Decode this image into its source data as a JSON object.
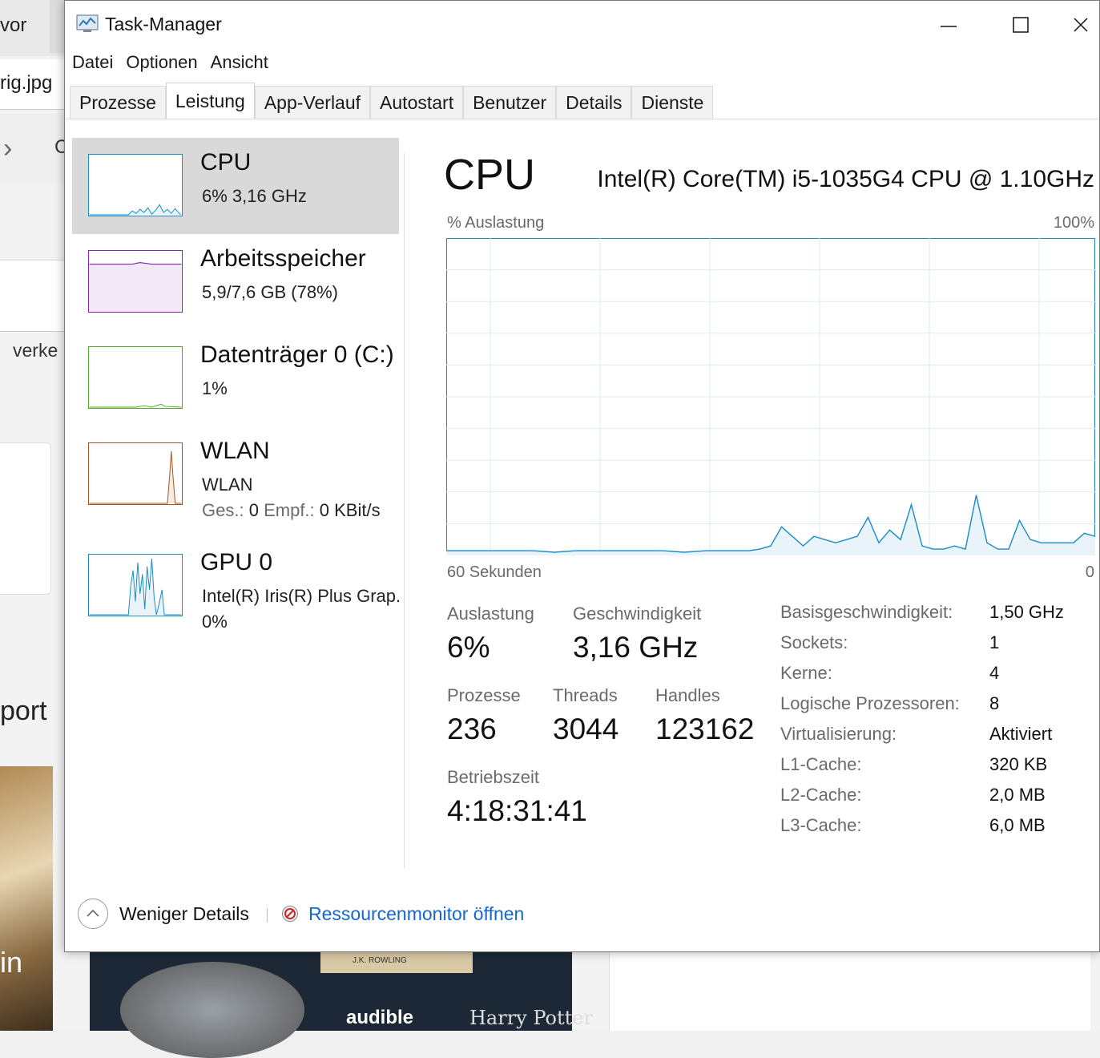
{
  "background": {
    "tab_text": "vor",
    "filename": "rig.jpg",
    "nav_letter": "C",
    "side_text": "verke",
    "heading": "port",
    "photo_text": "in",
    "ad_audible": "audible",
    "ad_hp": "Harry Potter",
    "ad_book": "J.K. ROWLING"
  },
  "window": {
    "title": "Task-Manager",
    "menu": [
      "Datei",
      "Optionen",
      "Ansicht"
    ],
    "tabs": [
      "Prozesse",
      "Leistung",
      "App-Verlauf",
      "Autostart",
      "Benutzer",
      "Details",
      "Dienste"
    ],
    "active_tab": "Leistung"
  },
  "sidebar": {
    "items": [
      {
        "name": "CPU",
        "line2": "6%  3,16 GHz",
        "color": "#1a8bc4"
      },
      {
        "name": "Arbeitsspeicher",
        "line2": "5,9/7,6 GB (78%)",
        "color": "#8b23a8"
      },
      {
        "name": "Datenträger 0 (C:)",
        "line2": "1%",
        "color": "#4ea82a"
      },
      {
        "name": "WLAN",
        "line2": "WLAN",
        "l3_a_label": "Ges.:",
        "l3_a_value": "0",
        "l3_b_label": "Empf.:",
        "l3_b_value": "0 KBit/s",
        "color": "#a4561d"
      },
      {
        "name": "GPU 0",
        "line2": "Intel(R) Iris(R) Plus Grap.",
        "line3": "0%",
        "color": "#1a8bc4"
      }
    ]
  },
  "main": {
    "title": "CPU",
    "model": "Intel(R) Core(TM) i5-1035G4 CPU @ 1.10GHz",
    "axis_top_left": "% Auslastung",
    "axis_top_right": "100%",
    "axis_bottom_left": "60 Sekunden",
    "axis_bottom_right": "0",
    "stats": {
      "auslastung_label": "Auslastung",
      "auslastung": "6%",
      "geschwindigkeit_label": "Geschwindigkeit",
      "geschwindigkeit": "3,16 GHz",
      "prozesse_label": "Prozesse",
      "prozesse": "236",
      "threads_label": "Threads",
      "threads": "3044",
      "handles_label": "Handles",
      "handles": "123162",
      "betriebszeit_label": "Betriebszeit",
      "betriebszeit": "4:18:31:41"
    },
    "specs": [
      {
        "k": "Basisgeschwindigkeit:",
        "v": "1,50 GHz"
      },
      {
        "k": "Sockets:",
        "v": "1"
      },
      {
        "k": "Kerne:",
        "v": "4"
      },
      {
        "k": "Logische Prozessoren:",
        "v": "8"
      },
      {
        "k": "Virtualisierung:",
        "v": "Aktiviert"
      },
      {
        "k": "L1-Cache:",
        "v": "320 KB"
      },
      {
        "k": "L2-Cache:",
        "v": "2,0 MB"
      },
      {
        "k": "L3-Cache:",
        "v": "6,0 MB"
      }
    ]
  },
  "footer": {
    "less_details": "Weniger Details",
    "resource_monitor": "Ressourcenmonitor öffnen"
  },
  "chart_data": {
    "type": "area",
    "x": [
      60,
      58,
      56,
      54,
      52,
      50,
      48,
      46,
      44,
      42,
      40,
      38,
      36,
      34,
      32,
      31,
      30,
      29,
      28,
      27,
      26,
      25,
      24,
      23,
      22,
      21,
      20,
      19,
      18,
      17,
      16,
      15,
      14,
      13,
      12,
      11,
      10,
      9,
      8,
      7,
      6,
      5,
      4,
      3,
      2,
      1,
      0
    ],
    "values": [
      1.5,
      1.5,
      1.5,
      1.5,
      1.5,
      1,
      1.5,
      1.5,
      1.5,
      1.5,
      1.5,
      1,
      1.5,
      1.5,
      1.5,
      2,
      3,
      9,
      6,
      3,
      6,
      5,
      4,
      5,
      6,
      12,
      4,
      8,
      5,
      16,
      3,
      2,
      2,
      3,
      2,
      19,
      4,
      2,
      2,
      11,
      5,
      4,
      4,
      4,
      4,
      7,
      6
    ],
    "ylim": [
      0,
      100
    ],
    "xlim": [
      60,
      0
    ],
    "grid": true,
    "color": "#1a8bc4"
  }
}
